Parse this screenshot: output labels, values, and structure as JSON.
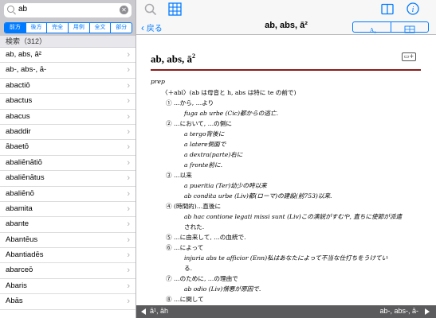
{
  "search": {
    "value": "ab"
  },
  "modes": [
    "前方",
    "後方",
    "完全",
    "用例",
    "全文",
    "部分"
  ],
  "results_header": "検索（312）",
  "results": [
    "ab, abs, ā²",
    "ab-, abs-, ā-",
    "abactiō",
    "abactus",
    "abacus",
    "abaddir",
    "ābaetō",
    "abaliēnātiō",
    "abaliēnātus",
    "abaliēnō",
    "abamita",
    "abante",
    "Abantēus",
    "Abantiadēs",
    "abarceō",
    "Abaris",
    "Abās"
  ],
  "nav": {
    "back": "戻る",
    "title": "ab, abs, ā²"
  },
  "entry": {
    "headword": "ab, abs, ā",
    "homograph": "2",
    "pos": "prep",
    "lines": [
      "〈＋abl〉(ab は母音と h, abs は特に te の前で)",
      "① …から, …より",
      "fuga ab urbe (Cic)都からの逃亡.",
      "② …において, …の側に",
      "a tergo背後に",
      "a latere側面で",
      "a dextra(parte)右に",
      "a fronte前に.",
      "③ …以来",
      "a pueritia (Ter)幼少の時以来",
      "ab condita urbe (Liv)都(ローマ)の建設(前753)以来.",
      "④ (時間的)…直後に",
      "ab hac contione legati missi sunt (Liv)この演説がすむや, 直ちに使節が派遣",
      "された.",
      "⑤ …に由来して, …の血統で.",
      "⑥ …によって",
      "injuria abs te afficior (Enn)私はあなたによって不当な仕打ちをうけてい",
      "る.",
      "⑦ …のために, …の理由で",
      "ab odio (Liv)憎悪が原因で.",
      "⑧ …に関して"
    ]
  },
  "bottom": {
    "prev": "ā¹, āh",
    "next": "ab-, abs-, ā-"
  },
  "colors": {
    "accent": "#007aff",
    "rule": "#8b1a1a",
    "bottombar": "#5b5b5d"
  }
}
